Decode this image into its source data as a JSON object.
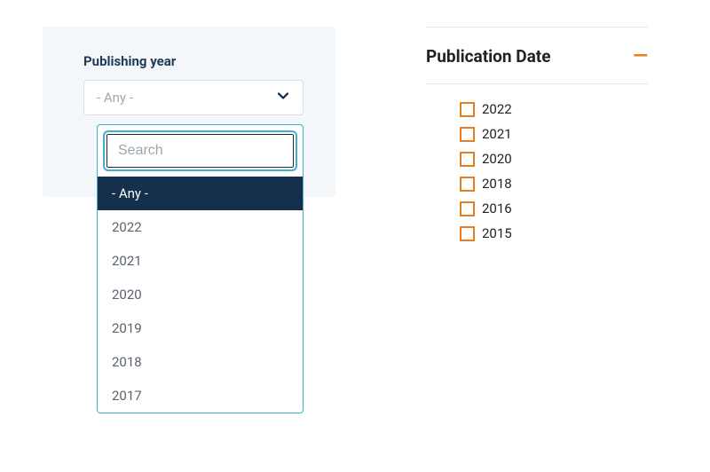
{
  "colors": {
    "navy": "#14304d",
    "orange": "#e67e22",
    "teal_border": "#3fb0cf"
  },
  "left": {
    "field_label": "Publishing year",
    "selected_value": "- Any -",
    "search_placeholder": "Search",
    "options": [
      {
        "label": "- Any -",
        "highlighted": true
      },
      {
        "label": "2022",
        "highlighted": false
      },
      {
        "label": "2021",
        "highlighted": false
      },
      {
        "label": "2020",
        "highlighted": false
      },
      {
        "label": "2019",
        "highlighted": false
      },
      {
        "label": "2018",
        "highlighted": false
      },
      {
        "label": "2017",
        "highlighted": false
      }
    ]
  },
  "right": {
    "title": "Publication Date",
    "collapse_glyph": "—",
    "items": [
      {
        "label": "2022"
      },
      {
        "label": "2021"
      },
      {
        "label": "2020"
      },
      {
        "label": "2018"
      },
      {
        "label": "2016"
      },
      {
        "label": "2015"
      }
    ]
  }
}
